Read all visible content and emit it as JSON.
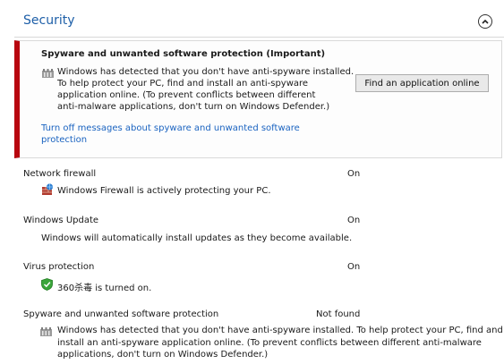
{
  "section": {
    "title": "Security"
  },
  "alert": {
    "title": "Spyware and unwanted software protection (Important)",
    "message_lines": [
      "Windows has detected that you don't have anti-spyware installed.",
      "To help protect your PC, find and install an anti-spyware",
      "application online. (To prevent conflicts between different",
      "anti-malware applications, don't turn on Windows Defender.)"
    ],
    "button_label": "Find an application online",
    "link_lines": [
      "Turn off messages about spyware and unwanted software",
      "protection"
    ],
    "accent_color": "#b8060f"
  },
  "items": [
    {
      "label": "Network firewall",
      "status": "On",
      "detail": "Windows Firewall is actively protecting your PC.",
      "icon": "firewall-icon"
    },
    {
      "label": "Windows Update",
      "status": "On",
      "detail": "Windows will automatically install updates as they become available."
    },
    {
      "label": "Virus protection",
      "status": "On",
      "detail": "360杀毒 is turned on.",
      "icon": "shield-icon"
    },
    {
      "label": "Spyware and unwanted software protection",
      "status": "Not found",
      "detail_lines": [
        "Windows has detected that you don't have anti-spyware installed. To help protect your PC, find and",
        "install an anti-spyware application online. (To prevent conflicts between different anti-malware",
        "applications, don't turn on Windows Defender.)"
      ],
      "icon": "castle-icon"
    }
  ],
  "colors": {
    "heading": "#1e5fa8",
    "link": "#1a63c0",
    "alert_border": "#b8060f"
  }
}
